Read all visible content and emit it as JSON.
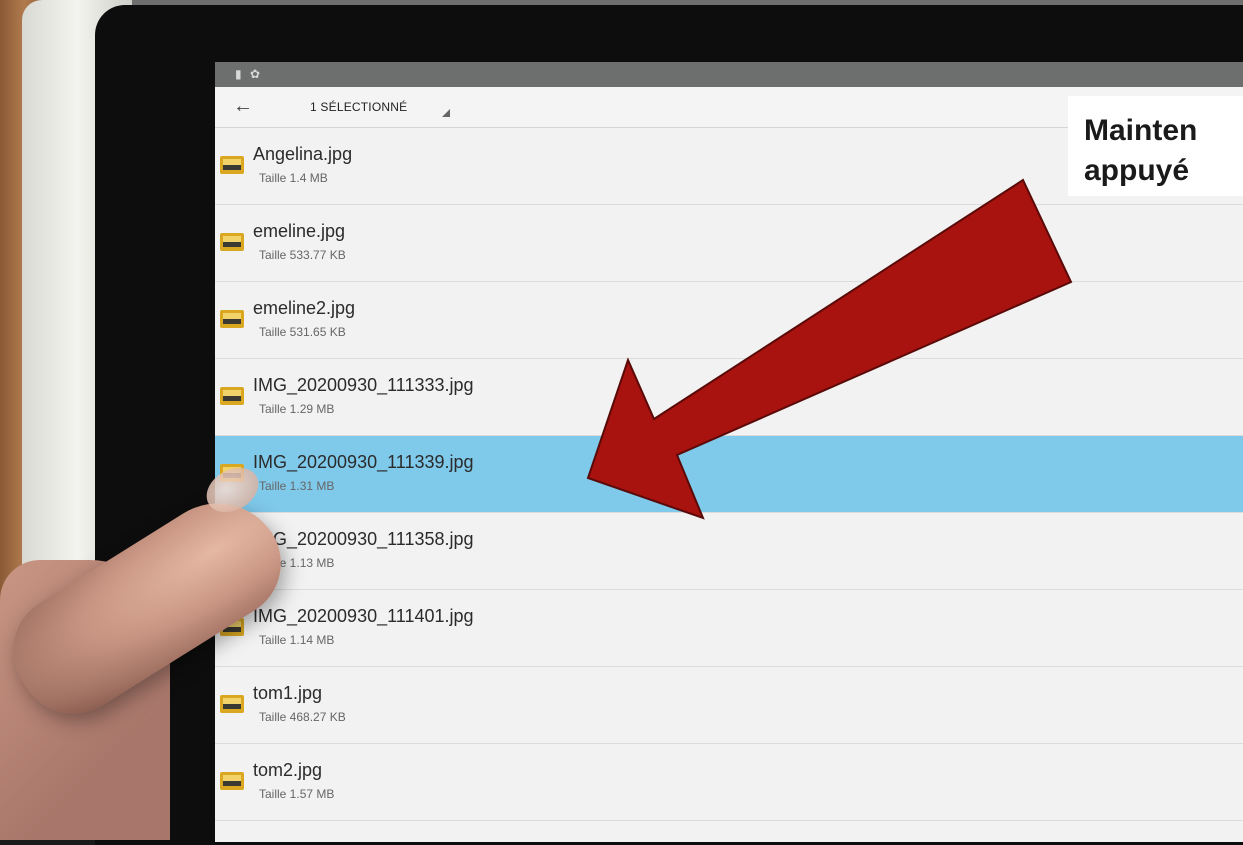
{
  "status_bar": {
    "left_icons": [
      "battery-icon",
      "gear-icon"
    ]
  },
  "app_bar": {
    "back_icon": "arrow-left-icon",
    "title": "1 SÉLECTIONNÉ"
  },
  "files": [
    {
      "name": "Angelina.jpg",
      "size": "Taille 1.4 MB",
      "selected": false
    },
    {
      "name": "emeline.jpg",
      "size": "Taille 533.77 KB",
      "selected": false
    },
    {
      "name": "emeline2.jpg",
      "size": "Taille 531.65 KB",
      "selected": false
    },
    {
      "name": "IMG_20200930_111333.jpg",
      "size": "Taille 1.29 MB",
      "selected": false
    },
    {
      "name": "IMG_20200930_111339.jpg",
      "size": "Taille 1.31 MB",
      "selected": true
    },
    {
      "name": "IMG_20200930_111358.jpg",
      "size": "Taille 1.13 MB",
      "selected": false
    },
    {
      "name": "IMG_20200930_111401.jpg",
      "size": "Taille 1.14 MB",
      "selected": false
    },
    {
      "name": "tom1.jpg",
      "size": "Taille 468.27 KB",
      "selected": false
    },
    {
      "name": "tom2.jpg",
      "size": "Taille 1.57 MB",
      "selected": false
    }
  ],
  "annotation": {
    "line1": "Mainten",
    "line2": "appuyé",
    "arrow_color": "#a8120f"
  },
  "colors": {
    "selected_row": "#7fc9eb",
    "status_bar": "#6c6f6e"
  }
}
